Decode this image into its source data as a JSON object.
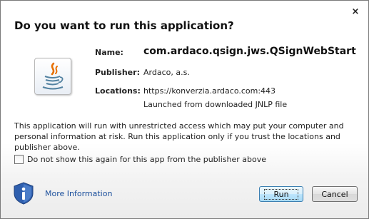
{
  "dialog": {
    "title": "Do you want to run this application?",
    "close_symbol": "×"
  },
  "icons": {
    "app": "java-logo-icon",
    "info": "shield-info-icon",
    "close": "close-icon"
  },
  "details": {
    "name_label": "Name:",
    "name_value": "com.ardaco.qsign.jws.QSignWebStart",
    "publisher_label": "Publisher:",
    "publisher_value": "Ardaco, a.s.",
    "locations_label": "Locations:",
    "location_url": "https://konverzia.ardaco.com:443",
    "location_note": "Launched from downloaded JNLP file"
  },
  "warning_text": "This application will run with unrestricted access which may put your computer and personal information at risk. Run this application only if you trust the locations and publisher above.",
  "checkbox": {
    "label": "Do not show this again for this app from the publisher above",
    "checked": false
  },
  "footer": {
    "more_info": "More Information",
    "run": "Run",
    "cancel": "Cancel"
  },
  "colors": {
    "link": "#1b4f9c",
    "default_button": "#a7d9f5"
  }
}
